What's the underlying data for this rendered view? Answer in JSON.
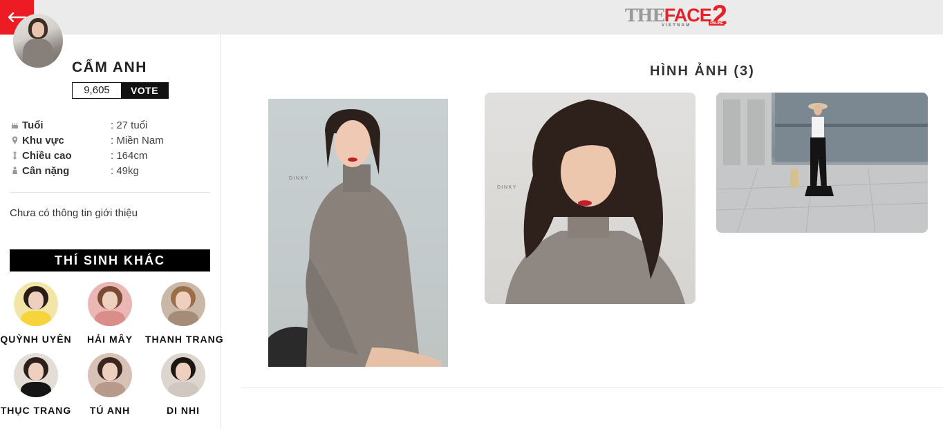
{
  "header": {
    "back_icon": "arrow-left-icon",
    "logo": {
      "the": "THE",
      "face": "FACE",
      "num": "2",
      "sub": "VIETNAM",
      "online": "ONLINE"
    },
    "accent": "#ed1c24"
  },
  "profile": {
    "name": "CẨM ANH",
    "votes": "9,605",
    "vote_label": "VOTE",
    "info": [
      {
        "icon": "cake-icon",
        "label": "Tuổi",
        "value": ": 27 tuổi"
      },
      {
        "icon": "location-pin-icon",
        "label": "Khu vực",
        "value": ": Miền Nam"
      },
      {
        "icon": "height-icon",
        "label": "Chiều cao",
        "value": ": 164cm"
      },
      {
        "icon": "weight-icon",
        "label": "Cân nặng",
        "value": ": 49kg"
      }
    ],
    "intro": "Chưa có thông tin giới thiệu"
  },
  "others": {
    "title": "THÍ SINH KHÁC",
    "contestants": [
      {
        "name": "QUỲNH UYÊN"
      },
      {
        "name": "HẢI MÂY"
      },
      {
        "name": "THANH TRANG"
      },
      {
        "name": "THỤC TRANG"
      },
      {
        "name": "TÚ ANH"
      },
      {
        "name": "DI NHI"
      }
    ]
  },
  "gallery": {
    "title": "HÌNH ẢNH (3)",
    "watermark": "DINKY"
  }
}
